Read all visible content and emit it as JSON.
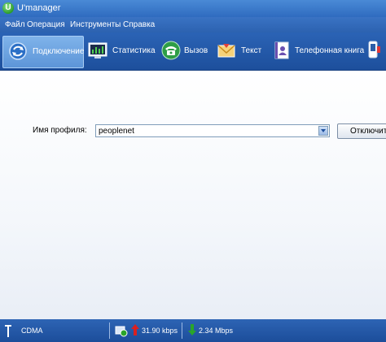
{
  "window": {
    "title": "U'manager",
    "icon_letter": "U"
  },
  "menu": {
    "items": [
      {
        "label": "Файл"
      },
      {
        "label": "Операция"
      },
      {
        "label": "Инструменты"
      },
      {
        "label": "Справка"
      }
    ]
  },
  "toolbar": {
    "items": [
      {
        "label": "Подключение",
        "icon": "connect-icon",
        "active": true
      },
      {
        "label": "Статистика",
        "icon": "statistics-icon",
        "active": false
      },
      {
        "label": "Вызов",
        "icon": "phone-icon",
        "active": false
      },
      {
        "label": "Текст",
        "icon": "envelope-icon",
        "active": false
      },
      {
        "label": "Телефонная книга",
        "icon": "phonebook-icon",
        "active": false
      }
    ]
  },
  "connection": {
    "profile_label": "Имя профиля:",
    "profile_value": "peoplenet",
    "disconnect_label": "Отключить"
  },
  "status": {
    "network": "CDMA",
    "upload_speed": "31.90 kbps",
    "download_speed": "2.34 Mbps"
  },
  "colors": {
    "titlebar": "#2f6bbf",
    "toolbar": "#1d4f9c",
    "upload_arrow": "#d92020",
    "download_arrow": "#2aa52a"
  }
}
